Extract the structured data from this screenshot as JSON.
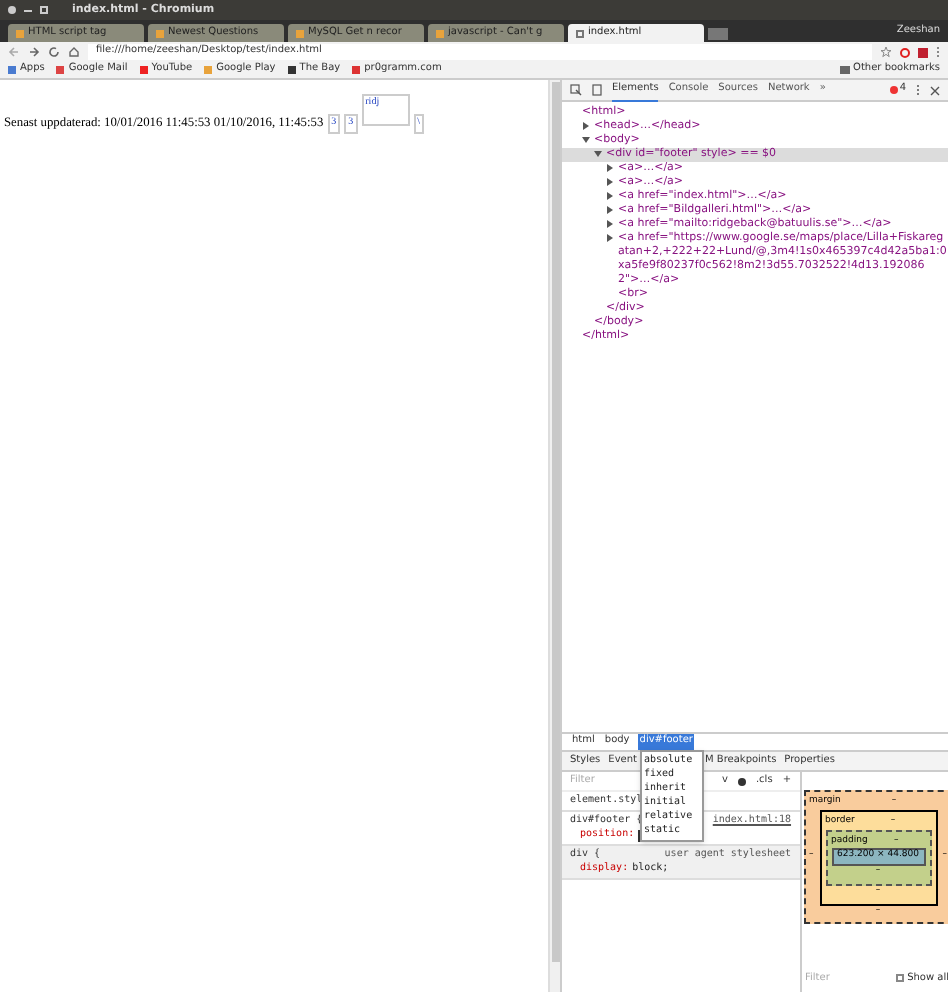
{
  "window": {
    "title": "index.html - Chromium",
    "user": "Zeeshan"
  },
  "tabs": [
    {
      "label": "HTML script tag",
      "selected": false
    },
    {
      "label": "Newest Questions",
      "selected": false
    },
    {
      "label": "MySQL Get n recor",
      "selected": false
    },
    {
      "label": "javascript - Can't g",
      "selected": false
    },
    {
      "label": "index.html",
      "selected": true
    }
  ],
  "address": "file:///home/zeeshan/Desktop/test/index.html",
  "bookmarks": [
    "Apps",
    "Google Mail",
    "YouTube",
    "Google Play",
    "The Bay",
    "pr0gramm.com"
  ],
  "other_bookmarks": "Other bookmarks",
  "page": {
    "text": "Senast uppdaterad: 10/01/2016 11:45:53 01/10/2016, 11:45:53",
    "images": [
      "3",
      "3",
      "ridj",
      "\\"
    ]
  },
  "devtools": {
    "tabs": [
      {
        "label": "Elements",
        "selected": true
      },
      {
        "label": "Console",
        "selected": false
      },
      {
        "label": "Sources",
        "selected": false
      },
      {
        "label": "Network",
        "selected": false
      }
    ],
    "more": "»",
    "errors": "4",
    "dom": [
      {
        "text": "<html>",
        "children": [
          {
            "text": "<head>…</head>",
            "expanded": false
          },
          {
            "text": "<body>",
            "expanded": true,
            "children": [
              {
                "text": "<div id=\"footer\" style> == $0",
                "expanded": true,
                "selected": true,
                "children": [
                  {
                    "text": "<a>…</a>",
                    "expanded": false
                  },
                  {
                    "text": "<a>…</a>",
                    "expanded": false
                  },
                  {
                    "text": "<a href=\"index.html\">…</a>",
                    "expanded": false
                  },
                  {
                    "text": "<a href=\"Bildgalleri.html\">…</a>",
                    "expanded": false
                  },
                  {
                    "text": "<a href=\"mailto:ridgeback@batuulis.se\">…</a>",
                    "expanded": false
                  },
                  {
                    "text": "<a href=\"https://www.google.se/maps/place/Lilla+Fiskaregatan+2,+222+22+Lund/@,3m4!1s0x465397c4d42a5ba1:0xa5fe9f80237f0c562!8m2!3d55.7032522!4d13.1920862\">…</a>",
                    "expanded": false
                  },
                  {
                    "text": "<br>"
                  }
                ]
              },
              {
                "text": "</div>"
              }
            ]
          },
          {
            "text": "</body>"
          }
        ]
      },
      {
        "text": "</html>"
      }
    ],
    "breadcrumbs": [
      {
        "label": "html",
        "selected": false
      },
      {
        "label": "body",
        "selected": false
      },
      {
        "label": "div#footer",
        "selected": true
      }
    ],
    "pane_tabs": [
      "Styles",
      "Event",
      "M Breakpoints",
      "Properties"
    ],
    "filter": {
      "placeholder": "Filter"
    },
    "toolbar": [
      "v",
      ".cls",
      "+"
    ],
    "rules": [
      {
        "selector": "element.styl"
      },
      {
        "selector": "div#footer {",
        "source": "index.html:18",
        "lines": [
          {
            "prop": "position:"
          }
        ]
      },
      {
        "selector": "div {",
        "source": "user agent stylesheet",
        "lines": [
          {
            "prop": "display:",
            "value": "block;"
          }
        ]
      }
    ],
    "dropdown": [
      "absolute",
      "fixed",
      "inherit",
      "initial",
      "relative",
      "static"
    ],
    "box": {
      "margin": "margin",
      "border": "border",
      "padding": "padding",
      "content": "623.200 × 44.800",
      "dash": "–"
    },
    "computed_filter": {
      "placeholder": "Filter"
    },
    "show_all": {
      "label": "Show all",
      "checked": false
    }
  }
}
